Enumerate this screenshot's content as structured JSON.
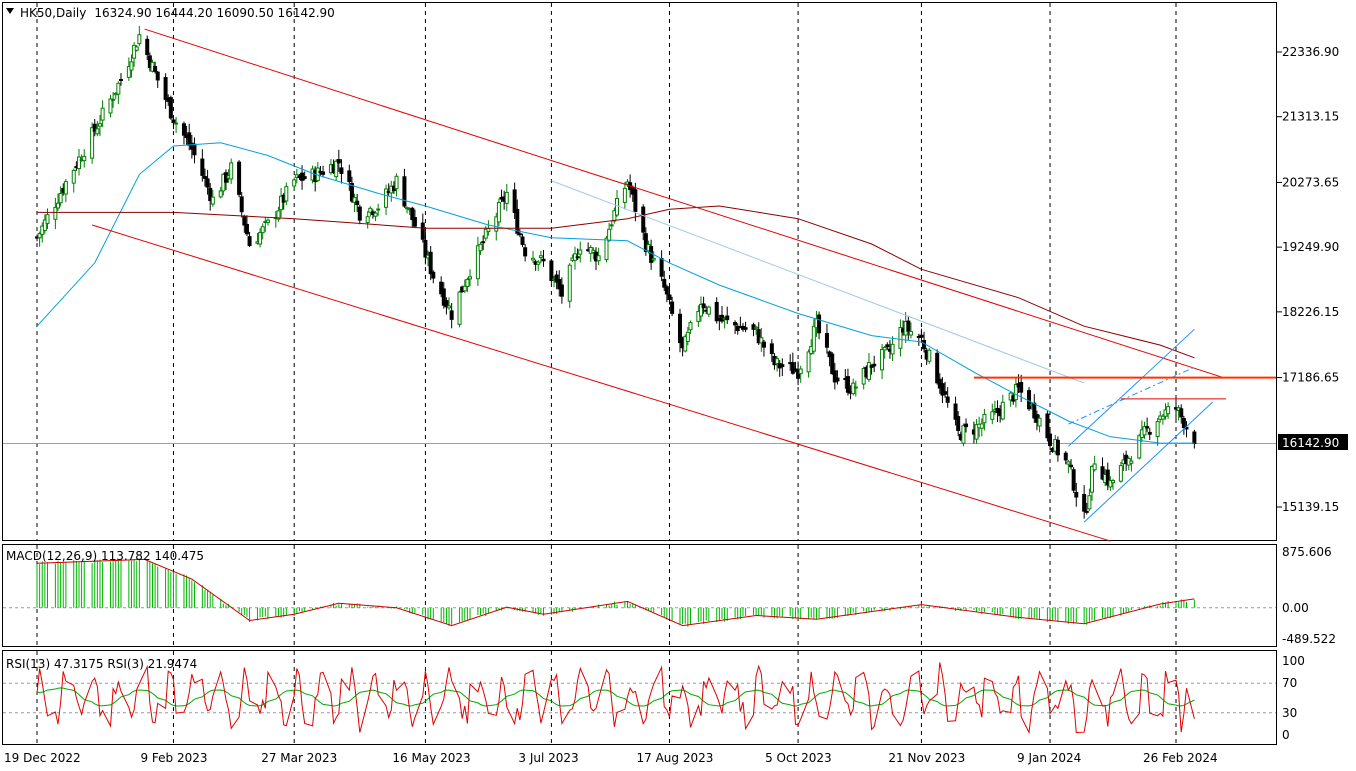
{
  "header": {
    "symbol": "HK50,Daily",
    "ohlc": "16324.90 16444.20 16090.50 16142.90",
    "collapse_icon": "triangle-down-icon"
  },
  "current_price_label": "16142.90",
  "colors": {
    "bull": "#008000",
    "bear": "#000000",
    "ma_fast": "#00a0e0",
    "ma_slow": "#8b0000",
    "channel_down": "#e00000",
    "channel_up": "#1e90ff",
    "resistance": "#ff3300",
    "macd_hist": "#00b400",
    "macd_signal": "#cc0000",
    "rsi_fast": "#e00000",
    "rsi_slow": "#00aa00",
    "grid": "#000000"
  },
  "macd": {
    "label": "MACD(12,26,9) 113.782 140.475",
    "ticks": [
      "875.606",
      "0.00",
      "-489.522"
    ]
  },
  "rsi": {
    "label": "RSI(13) 47.3175  RSI(3) 21.9474",
    "ticks": [
      "100",
      "70",
      "30",
      "0"
    ]
  },
  "chart_data": {
    "type": "candlestick",
    "instrument": "HK50",
    "timeframe": "Daily",
    "last_bar": {
      "open": 16324.9,
      "high": 16444.2,
      "low": 16090.5,
      "close": 16142.9
    },
    "price_axis_ticks": [
      "22336.90",
      "21313.15",
      "20273.65",
      "19249.90",
      "18226.15",
      "17186.65",
      "15139.15"
    ],
    "price_range": [
      14600,
      23000
    ],
    "x_labels": [
      "19 Dec 2022",
      "9 Feb 2023",
      "27 Mar 2023",
      "16 May 2023",
      "3 Jul 2023",
      "17 Aug 2023",
      "5 Oct 2023",
      "21 Nov 2023",
      "9 Jan 2024",
      "26 Feb 2024"
    ],
    "close_path": [
      {
        "date": "19 Dec 2022",
        "close": 19400
      },
      {
        "date": "29 Dec 2022",
        "close": 20200
      },
      {
        "date": "10 Jan 2023",
        "close": 21100
      },
      {
        "date": "20 Jan 2023",
        "close": 21900
      },
      {
        "date": "27 Jan 2023",
        "close": 22600
      },
      {
        "date": "2 Feb 2023",
        "close": 22000
      },
      {
        "date": "9 Feb 2023",
        "close": 21300
      },
      {
        "date": "16 Feb 2023",
        "close": 20800
      },
      {
        "date": "24 Feb 2023",
        "close": 20000
      },
      {
        "date": "3 Mar 2023",
        "close": 20500
      },
      {
        "date": "10 Mar 2023",
        "close": 19300
      },
      {
        "date": "17 Mar 2023",
        "close": 19600
      },
      {
        "date": "27 Mar 2023",
        "close": 20300
      },
      {
        "date": "4 Apr 2023",
        "close": 20400
      },
      {
        "date": "13 Apr 2023",
        "close": 20600
      },
      {
        "date": "21 Apr 2023",
        "close": 19800
      },
      {
        "date": "28 Apr 2023",
        "close": 19900
      },
      {
        "date": "5 May 2023",
        "close": 20300
      },
      {
        "date": "12 May 2023",
        "close": 19600
      },
      {
        "date": "19 May 2023",
        "close": 18800
      },
      {
        "date": "26 May 2023",
        "close": 18200
      },
      {
        "date": "2 Jun 2023",
        "close": 18900
      },
      {
        "date": "9 Jun 2023",
        "close": 19500
      },
      {
        "date": "16 Jun 2023",
        "close": 20100
      },
      {
        "date": "23 Jun 2023",
        "close": 19200
      },
      {
        "date": "30 Jun 2023",
        "close": 19000
      },
      {
        "date": "7 Jul 2023",
        "close": 18500
      },
      {
        "date": "14 Jul 2023",
        "close": 19300
      },
      {
        "date": "21 Jul 2023",
        "close": 19100
      },
      {
        "date": "28 Jul 2023",
        "close": 19900
      },
      {
        "date": "1 Aug 2023",
        "close": 20300
      },
      {
        "date": "8 Aug 2023",
        "close": 19300
      },
      {
        "date": "15 Aug 2023",
        "close": 18600
      },
      {
        "date": "22 Aug 2023",
        "close": 17600
      },
      {
        "date": "29 Aug 2023",
        "close": 18400
      },
      {
        "date": "5 Sep 2023",
        "close": 18100
      },
      {
        "date": "12 Sep 2023",
        "close": 18000
      },
      {
        "date": "19 Sep 2023",
        "close": 17900
      },
      {
        "date": "26 Sep 2023",
        "close": 17400
      },
      {
        "date": "5 Oct 2023",
        "close": 17300
      },
      {
        "date": "12 Oct 2023",
        "close": 18000
      },
      {
        "date": "19 Oct 2023",
        "close": 17200
      },
      {
        "date": "26 Oct 2023",
        "close": 17000
      },
      {
        "date": "2 Nov 2023",
        "close": 17400
      },
      {
        "date": "9 Nov 2023",
        "close": 17600
      },
      {
        "date": "14 Nov 2023",
        "close": 18000
      },
      {
        "date": "21 Nov 2023",
        "close": 17800
      },
      {
        "date": "28 Nov 2023",
        "close": 17100
      },
      {
        "date": "5 Dec 2023",
        "close": 16300
      },
      {
        "date": "12 Dec 2023",
        "close": 16400
      },
      {
        "date": "19 Dec 2023",
        "close": 16600
      },
      {
        "date": "28 Dec 2023",
        "close": 17000
      },
      {
        "date": "4 Jan 2024",
        "close": 16600
      },
      {
        "date": "9 Jan 2024",
        "close": 16200
      },
      {
        "date": "16 Jan 2024",
        "close": 15800
      },
      {
        "date": "22 Jan 2024",
        "close": 14950
      },
      {
        "date": "26 Jan 2024",
        "close": 15900
      },
      {
        "date": "1 Feb 2024",
        "close": 15500
      },
      {
        "date": "6 Feb 2024",
        "close": 15800
      },
      {
        "date": "14 Feb 2024",
        "close": 16300
      },
      {
        "date": "20 Feb 2024",
        "close": 16600
      },
      {
        "date": "26 Feb 2024",
        "close": 16700
      },
      {
        "date": "29 Feb 2024",
        "close": 16500
      },
      {
        "date": "4 Mar 2024",
        "close": 16142.9
      }
    ],
    "ma_fast_path": [
      {
        "date": "19 Dec 2022",
        "value": 18000
      },
      {
        "date": "10 Jan 2023",
        "value": 19000
      },
      {
        "date": "27 Jan 2023",
        "value": 20400
      },
      {
        "date": "9 Feb 2023",
        "value": 20850
      },
      {
        "date": "27 Feb 2023",
        "value": 20900
      },
      {
        "date": "17 Mar 2023",
        "value": 20700
      },
      {
        "date": "4 Apr 2023",
        "value": 20400
      },
      {
        "date": "28 Apr 2023",
        "value": 20100
      },
      {
        "date": "16 May 2023",
        "value": 19900
      },
      {
        "date": "9 Jun 2023",
        "value": 19600
      },
      {
        "date": "3 Jul 2023",
        "value": 19400
      },
      {
        "date": "1 Aug 2023",
        "value": 19350
      },
      {
        "date": "17 Aug 2023",
        "value": 19000
      },
      {
        "date": "5 Sep 2023",
        "value": 18650
      },
      {
        "date": "5 Oct 2023",
        "value": 18200
      },
      {
        "date": "2 Nov 2023",
        "value": 17850
      },
      {
        "date": "21 Nov 2023",
        "value": 17750
      },
      {
        "date": "12 Dec 2023",
        "value": 17250
      },
      {
        "date": "28 Dec 2023",
        "value": 16900
      },
      {
        "date": "16 Jan 2024",
        "value": 16500
      },
      {
        "date": "1 Feb 2024",
        "value": 16250
      },
      {
        "date": "20 Feb 2024",
        "value": 16150
      },
      {
        "date": "4 Mar 2024",
        "value": 16150
      }
    ],
    "ma_slow_path": [
      {
        "date": "19 Dec 2022",
        "value": 19800
      },
      {
        "date": "9 Feb 2023",
        "value": 19800
      },
      {
        "date": "27 Mar 2023",
        "value": 19700
      },
      {
        "date": "16 May 2023",
        "value": 19550
      },
      {
        "date": "3 Jul 2023",
        "value": 19550
      },
      {
        "date": "1 Aug 2023",
        "value": 19700
      },
      {
        "date": "17 Aug 2023",
        "value": 19850
      },
      {
        "date": "5 Sep 2023",
        "value": 19900
      },
      {
        "date": "5 Oct 2023",
        "value": 19700
      },
      {
        "date": "2 Nov 2023",
        "value": 19300
      },
      {
        "date": "21 Nov 2023",
        "value": 18900
      },
      {
        "date": "28 Dec 2023",
        "value": 18450
      },
      {
        "date": "22 Jan 2024",
        "value": 18000
      },
      {
        "date": "20 Feb 2024",
        "value": 17700
      },
      {
        "date": "4 Mar 2024",
        "value": 17500
      }
    ],
    "annotations": {
      "descending_channel_upper": [
        {
          "date": "29 Jan 2023",
          "price": 22700
        },
        {
          "date": "15 Mar 2024",
          "price": 17186.65
        }
      ],
      "descending_channel_lower": [
        {
          "date": "9 Jan 2023",
          "price": 19600
        },
        {
          "date": "1 Feb 2024",
          "price": 14600
        }
      ],
      "descending_channel_mid": [
        {
          "date": "3 Jul 2023",
          "price": 20300
        },
        {
          "date": "22 Jan 2024",
          "price": 17100
        }
      ],
      "resistance_level": 17186.65,
      "resistance_start": "11 Dec 2023",
      "short_resistance": 16850,
      "ascending_channel_lower": [
        {
          "date": "22 Jan 2024",
          "price": 14900
        },
        {
          "date": "11 Mar 2024",
          "price": 16800
        }
      ],
      "ascending_channel_upper": [
        {
          "date": "16 Jan 2024",
          "price": 16100
        },
        {
          "date": "4 Mar 2024",
          "price": 17950
        }
      ]
    },
    "macd_signal_path": [
      {
        "date": "19 Dec 2022",
        "value": 700
      },
      {
        "date": "29 Jan 2023",
        "value": 760
      },
      {
        "date": "16 Feb 2023",
        "value": 450
      },
      {
        "date": "10 Mar 2023",
        "value": -200
      },
      {
        "date": "27 Mar 2023",
        "value": -100
      },
      {
        "date": "13 Apr 2023",
        "value": 70
      },
      {
        "date": "5 May 2023",
        "value": 0
      },
      {
        "date": "26 May 2023",
        "value": -280
      },
      {
        "date": "16 Jun 2023",
        "value": 10
      },
      {
        "date": "30 Jun 2023",
        "value": -100
      },
      {
        "date": "1 Aug 2023",
        "value": 100
      },
      {
        "date": "22 Aug 2023",
        "value": -280
      },
      {
        "date": "19 Sep 2023",
        "value": -120
      },
      {
        "date": "12 Oct 2023",
        "value": -180
      },
      {
        "date": "21 Nov 2023",
        "value": 50
      },
      {
        "date": "28 Dec 2023",
        "value": -150
      },
      {
        "date": "22 Jan 2024",
        "value": -250
      },
      {
        "date": "20 Feb 2024",
        "value": 60
      },
      {
        "date": "4 Mar 2024",
        "value": 140
      }
    ],
    "rsi_levels": [
      70,
      30
    ]
  }
}
